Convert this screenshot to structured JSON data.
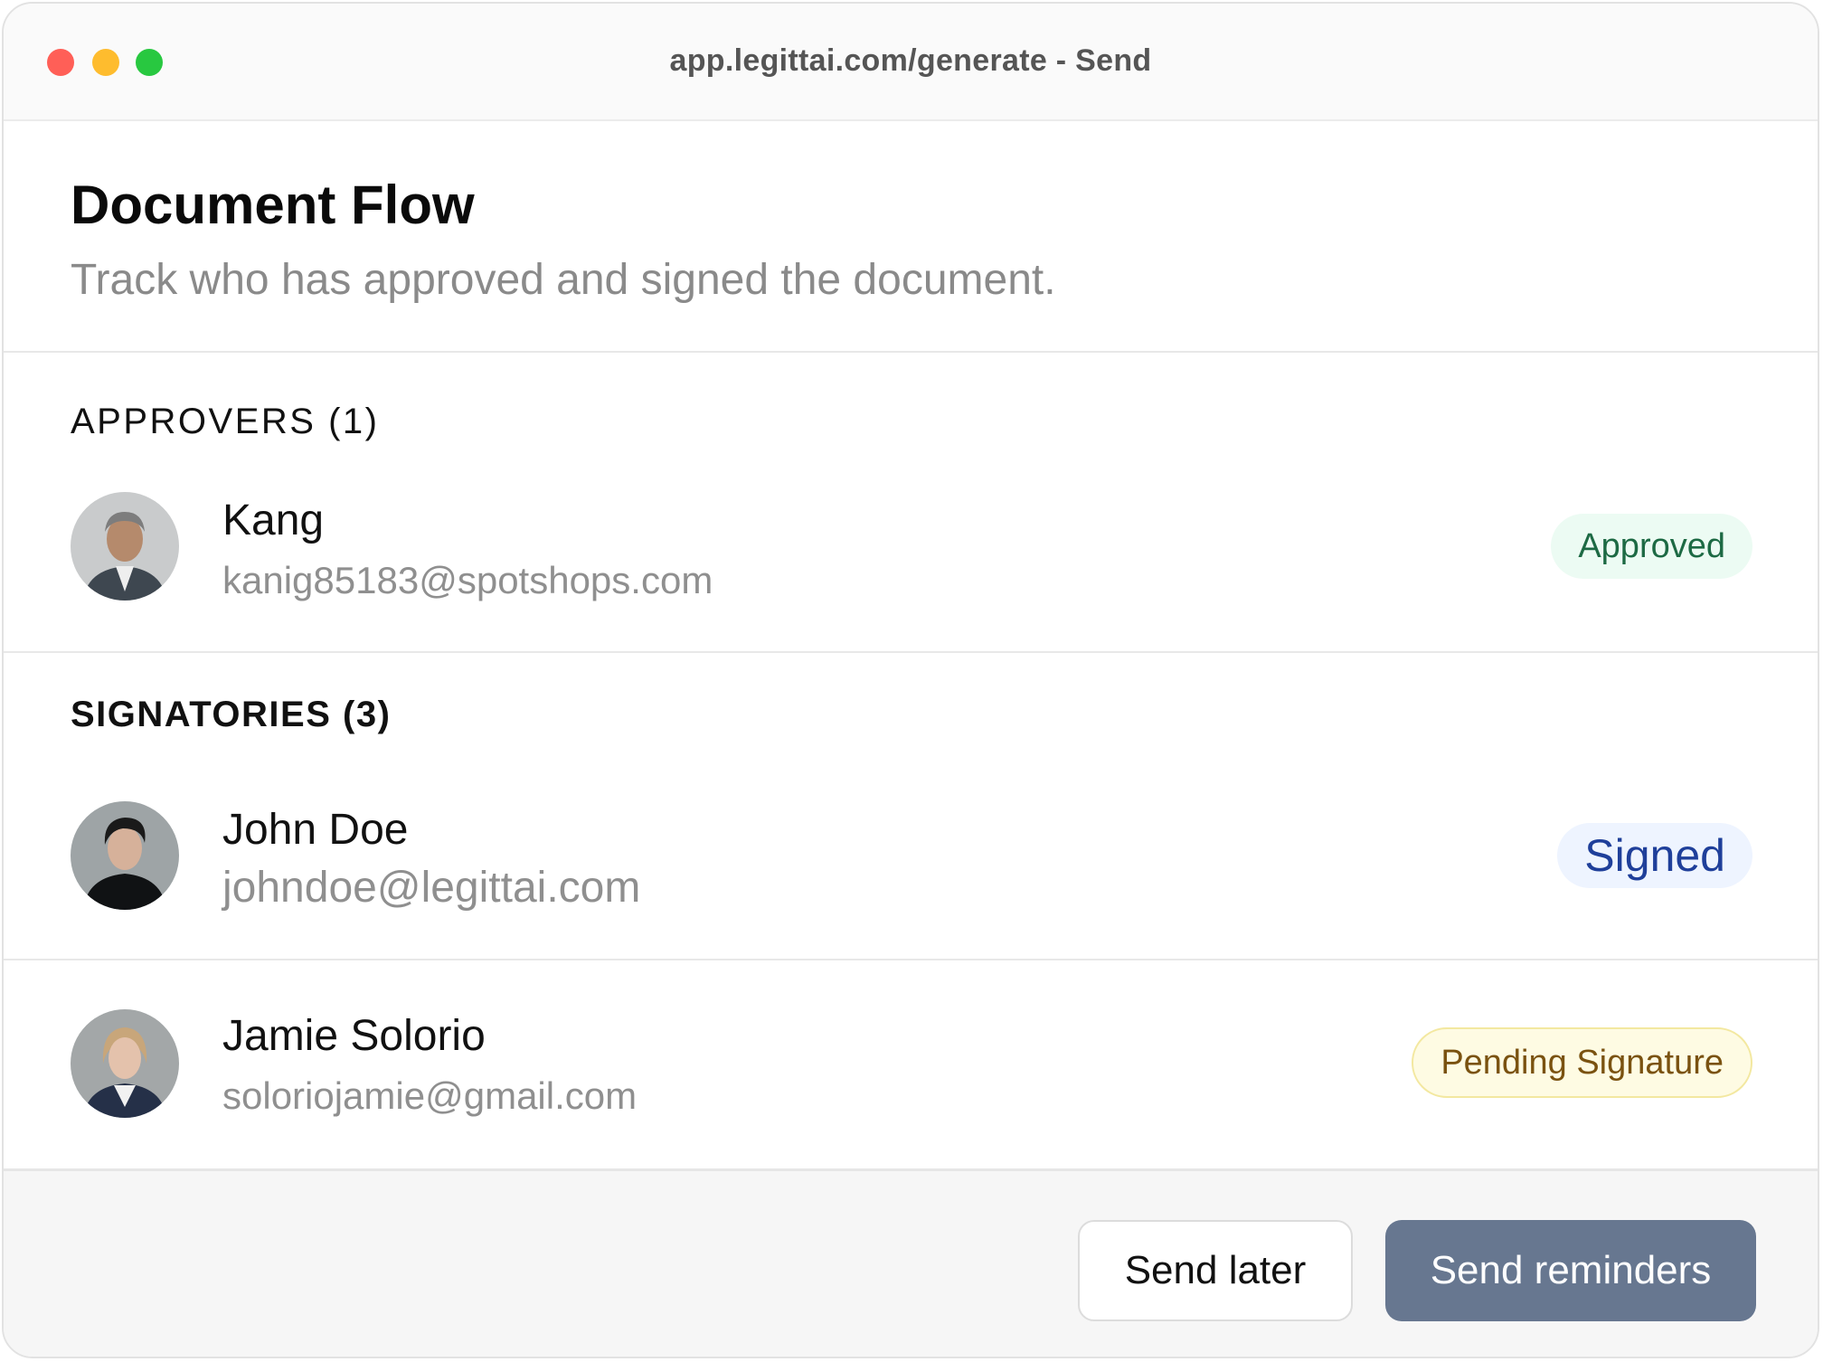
{
  "window": {
    "url_title": "app.legittai.com/generate - Send"
  },
  "header": {
    "title": "Document Flow",
    "subtitle": "Track who has approved and signed the document."
  },
  "approvers": {
    "label": "APPROVERS (1)",
    "items": [
      {
        "name": "Kang",
        "email": "kanig85183@spotshops.com",
        "status": "Approved",
        "avatar_icon": "avatar-man-gray-hair"
      }
    ]
  },
  "signatories": {
    "label": "SIGNATORIES (3)",
    "items": [
      {
        "name": "John Doe",
        "email": "johndoe@legittai.com",
        "status": "Signed",
        "avatar_icon": "avatar-man-black-turtleneck"
      },
      {
        "name": "Jamie Solorio",
        "email": "soloriojamie@gmail.com",
        "status": "Pending Signature",
        "avatar_icon": "avatar-woman-blonde"
      }
    ]
  },
  "footer": {
    "send_later_label": "Send later",
    "send_reminders_label": "Send reminders"
  },
  "colors": {
    "primary_button": "#677790",
    "approved": "#1d6a44",
    "signed": "#1f3f9a",
    "pending": "#7a5210"
  }
}
